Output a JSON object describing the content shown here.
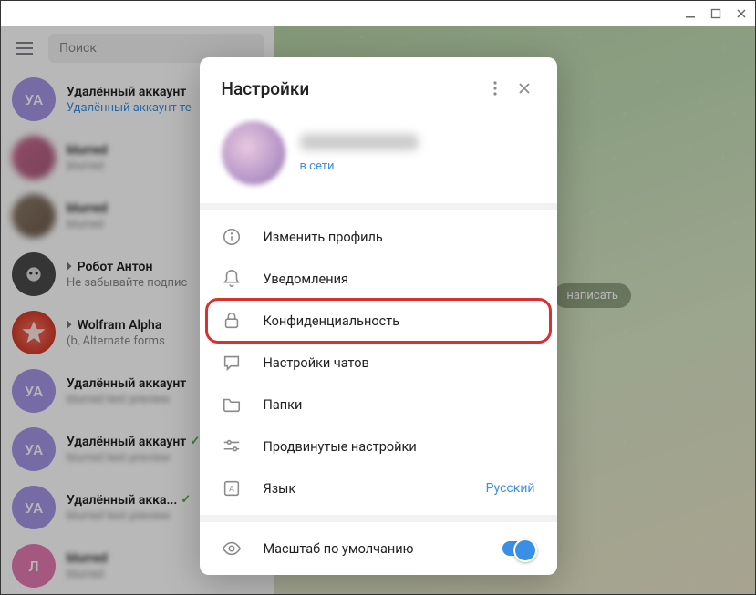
{
  "titlebar": {},
  "sidebar": {
    "search_placeholder": "Поиск",
    "chats": [
      {
        "avatar_initials": "УА",
        "name": "Удалённый аккаунт",
        "sub": "Удалённый аккаунт те",
        "sub_style": "blue"
      },
      {
        "name": "—",
        "sub": "—",
        "blur": true
      },
      {
        "name": "—",
        "sub": "—",
        "blur": true
      },
      {
        "bot": true,
        "name": "Робот Антон",
        "sub": "Не забывайте подпис"
      },
      {
        "bot": true,
        "name": "Wolfram Alpha",
        "sub": "(b, Alternate forms"
      },
      {
        "avatar_initials": "УА",
        "name": "Удалённый аккаунт",
        "sub": "—",
        "blur_sub": true
      },
      {
        "avatar_initials": "УА",
        "name": "Удалённый аккаунт",
        "sub": "—",
        "checked": true,
        "blur_sub": true
      },
      {
        "avatar_initials": "УА",
        "name": "Удалённый акка...",
        "sub": "—",
        "checked": true,
        "blur_sub": true
      },
      {
        "avatar_initials": "Л",
        "name": "—",
        "sub": "—",
        "blur": true
      }
    ]
  },
  "main": {
    "write_hint": "написать"
  },
  "modal": {
    "title": "Настройки",
    "profile": {
      "status": "в сети"
    },
    "items": [
      {
        "icon": "info",
        "label": "Изменить профиль"
      },
      {
        "icon": "bell",
        "label": "Уведомления"
      },
      {
        "icon": "lock",
        "label": "Конфиденциальность",
        "highlight": true
      },
      {
        "icon": "chat",
        "label": "Настройки чатов"
      },
      {
        "icon": "folder",
        "label": "Папки"
      },
      {
        "icon": "sliders",
        "label": "Продвинутые настройки"
      },
      {
        "icon": "lang",
        "label": "Язык",
        "value": "Русский"
      }
    ],
    "scale": {
      "icon": "eye",
      "label": "Масштаб по умолчанию",
      "toggle": true
    }
  }
}
